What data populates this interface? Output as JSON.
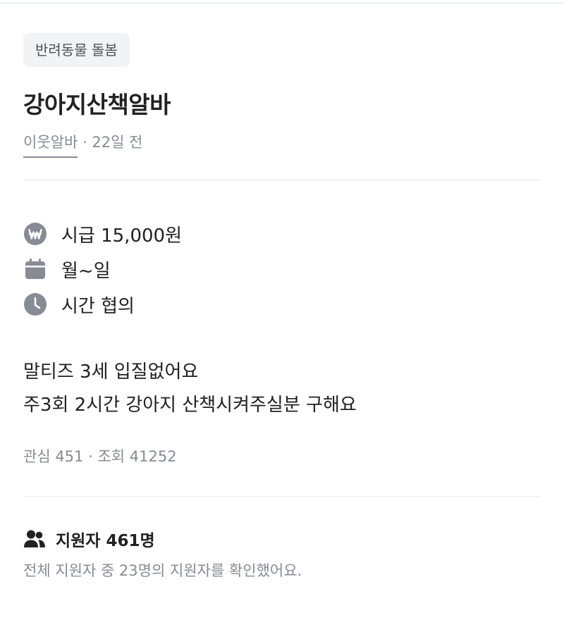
{
  "post": {
    "category": "반려동물 돌봄",
    "title": "강아지산책알바",
    "author": "이웃알바",
    "separator": "·",
    "posted_ago": "22일 전"
  },
  "info": {
    "wage_icon": "won-icon",
    "wage": "시급 15,000원",
    "days_icon": "calendar-icon",
    "days": "월~일",
    "time_icon": "clock-icon",
    "time": "시간 협의"
  },
  "description": {
    "line1": "말티즈 3세 입질없어요",
    "line2": "주3회 2시간 강아지 산책시켜주실분 구해요"
  },
  "stats": {
    "interest": "관심 451",
    "separator": "·",
    "views": "조회 41252"
  },
  "applicants": {
    "icon": "people-icon",
    "label": "지원자 461명",
    "summary": "전체 지원자 중 23명의 지원자를 확인했어요."
  },
  "colors": {
    "primary_text": "#212124",
    "secondary_text": "#868b94",
    "icon": "#868b94",
    "chip_bg": "#f2f3f6",
    "divider": "#eaebee"
  }
}
